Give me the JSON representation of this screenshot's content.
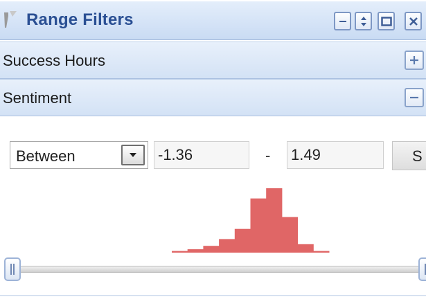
{
  "panel": {
    "title": "Range Filters",
    "title_color": "#2a4f93",
    "window_buttons": [
      "minimize-icon",
      "resize-icon",
      "maximize-icon",
      "close-icon"
    ]
  },
  "sections": [
    {
      "label": "Success Hours",
      "state": "collapsed",
      "toggle_icon": "plus-icon"
    },
    {
      "label": "Sentiment",
      "state": "expanded",
      "toggle_icon": "minus-icon"
    }
  ],
  "filter": {
    "operator": "Between",
    "min_value": "-1.36",
    "separator": "-",
    "max_value": "1.49",
    "submit_label_visible": "S"
  },
  "histogram": {
    "bar_color": "#e06666",
    "bins": [
      1,
      2,
      4,
      8,
      14,
      32,
      38,
      21,
      5,
      1
    ]
  },
  "slider": {
    "min_fraction": 0.0,
    "max_fraction": 1.0
  }
}
